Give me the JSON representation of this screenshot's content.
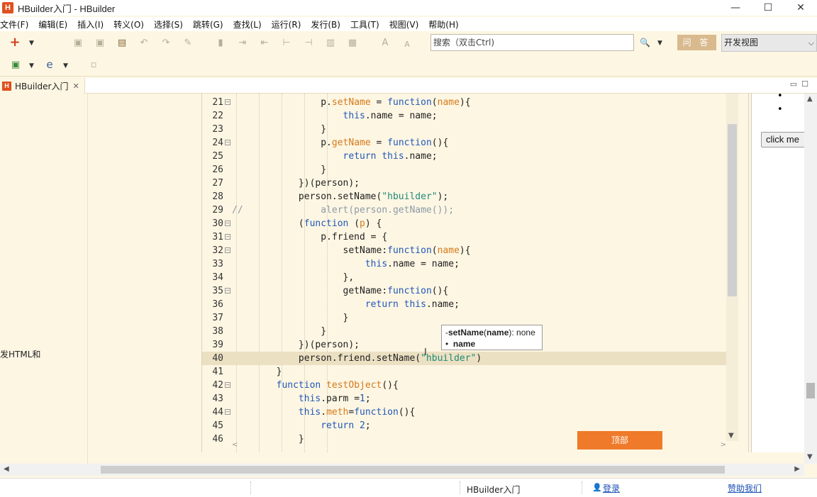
{
  "window": {
    "title": "HBuilder入门  -  HBuilder",
    "logo_letter": "H",
    "controls": {
      "minimize": "—",
      "maximize": "☐",
      "close": "✕"
    }
  },
  "menu": [
    "文件(F)",
    "编辑(E)",
    "插入(I)",
    "转义(O)",
    "选择(S)",
    "跳转(G)",
    "查找(L)",
    "运行(R)",
    "发行(B)",
    "工具(T)",
    "视图(V)",
    "帮助(H)"
  ],
  "toolbar": {
    "search_placeholder": "搜索（双击Ctrl)",
    "qa_label": "问 答",
    "view_select": "开发视图"
  },
  "tabs": [
    {
      "label": "HBuilder入门",
      "close": "✕"
    }
  ],
  "left_panel": {
    "truncated_text": "发HTML和"
  },
  "editor": {
    "current_line": 40,
    "lines": [
      {
        "n": "21",
        "fold": true,
        "html": "                <span>p.</span><span class=\"prop\">setName</span> = <span class=\"kw\">function</span>(<span class=\"fn\">name</span>){"
      },
      {
        "n": "22",
        "fold": false,
        "html": "                    <span class=\"kw\">this</span>.name = name;"
      },
      {
        "n": "23",
        "fold": false,
        "html": "                }"
      },
      {
        "n": "24",
        "fold": true,
        "html": "                p.<span class=\"prop\">getName</span> = <span class=\"kw\">function</span>(){"
      },
      {
        "n": "25",
        "fold": false,
        "html": "                    <span class=\"kw\">return</span> <span class=\"kw\">this</span>.name;"
      },
      {
        "n": "26",
        "fold": false,
        "html": "                }"
      },
      {
        "n": "27",
        "fold": false,
        "html": "            })(person);"
      },
      {
        "n": "28",
        "fold": false,
        "html": "            person.setName(<span class=\"str\">\"hbuilder\"</span>);"
      },
      {
        "n": "29",
        "fold": false,
        "html": "<span class=\"cmt\">//              alert(person.getName());</span>"
      },
      {
        "n": "30",
        "fold": true,
        "html": "            (<span class=\"kw\">function</span> (<span class=\"fn\">p</span>) {"
      },
      {
        "n": "31",
        "fold": true,
        "html": "                p.friend = {"
      },
      {
        "n": "32",
        "fold": true,
        "html": "                    setName:<span class=\"kw\">function</span>(<span class=\"fn\">name</span>){"
      },
      {
        "n": "33",
        "fold": false,
        "html": "                        <span class=\"kw\">this</span>.name = name;"
      },
      {
        "n": "34",
        "fold": false,
        "html": "                    },"
      },
      {
        "n": "35",
        "fold": true,
        "html": "                    getName:<span class=\"kw\">function</span>(){"
      },
      {
        "n": "36",
        "fold": false,
        "html": "                        <span class=\"kw\">return</span> <span class=\"kw\">this</span>.name;"
      },
      {
        "n": "37",
        "fold": false,
        "html": "                    }"
      },
      {
        "n": "38",
        "fold": false,
        "html": "                }"
      },
      {
        "n": "39",
        "fold": false,
        "html": "            })(person);"
      },
      {
        "n": "40",
        "fold": false,
        "html": "            person.friend.setName(<span class=\"str\">\"hbuilder\"</span>)"
      },
      {
        "n": "41",
        "fold": false,
        "html": "        }"
      },
      {
        "n": "42",
        "fold": true,
        "html": "        <span class=\"kw\">function</span> <span class=\"fn\">testObject</span>(){"
      },
      {
        "n": "43",
        "fold": false,
        "html": "            <span class=\"kw\">this</span>.parm =<span class=\"num\">1</span>;"
      },
      {
        "n": "44",
        "fold": true,
        "html": "            <span class=\"kw\">this</span>.<span class=\"prop\">meth</span>=<span class=\"kw\">function</span>(){"
      },
      {
        "n": "45",
        "fold": false,
        "html": "                <span class=\"kw\">return</span> <span class=\"num\">2</span>;"
      },
      {
        "n": "46",
        "fold": false,
        "html": "            }"
      }
    ]
  },
  "hint": {
    "signature_fn": "setName",
    "signature_param": "name",
    "signature_ret": ": none",
    "param_item": "name"
  },
  "top_button": "顶部",
  "preview": {
    "bullets": [
      "•",
      "•"
    ],
    "button": "click me"
  },
  "status": {
    "file": "HBuilder入门",
    "login": "登录",
    "sponsor": "赞助我们"
  }
}
